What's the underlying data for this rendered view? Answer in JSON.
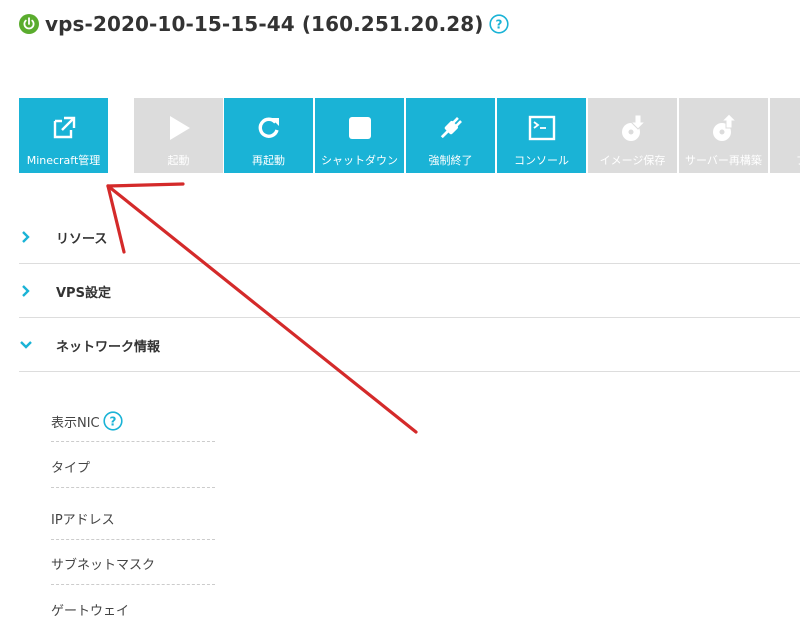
{
  "header": {
    "title": "vps-2020-10-15-15-44 (160.251.20.28)",
    "status_color": "#5aac2e",
    "help_color": "#1ab3d6"
  },
  "toolbar": {
    "accent": "#1ab3d6",
    "disabled_color": "#dcdcdc",
    "buttons": [
      {
        "label": "Minecraft管理",
        "icon": "external-link-icon",
        "state": "active"
      },
      {
        "label": "起動",
        "icon": "play-icon",
        "state": "disabled"
      },
      {
        "label": "再起動",
        "icon": "restart-icon",
        "state": "active"
      },
      {
        "label": "シャットダウン",
        "icon": "stop-icon",
        "state": "active"
      },
      {
        "label": "強制終了",
        "icon": "plug-icon",
        "state": "active"
      },
      {
        "label": "コンソール",
        "icon": "console-icon",
        "state": "active"
      },
      {
        "label": "イメージ保存",
        "icon": "disk-download-icon",
        "state": "disabled"
      },
      {
        "label": "サーバー再構築",
        "icon": "disk-upload-icon",
        "state": "disabled"
      },
      {
        "label": "プ",
        "icon": "",
        "state": "disabled"
      }
    ]
  },
  "sections": [
    {
      "label": "リソース",
      "expanded": false
    },
    {
      "label": "VPS設定",
      "expanded": false
    },
    {
      "label": "ネットワーク情報",
      "expanded": true
    }
  ],
  "network": {
    "rows": [
      {
        "label": "表示NIC",
        "help": true
      },
      {
        "label": "タイプ",
        "help": false
      },
      {
        "label": "IPアドレス",
        "help": false
      },
      {
        "label": "サブネットマスク",
        "help": false
      },
      {
        "label": "ゲートウェイ",
        "help": false
      }
    ]
  },
  "annotation": {
    "color": "#d42a2a"
  }
}
